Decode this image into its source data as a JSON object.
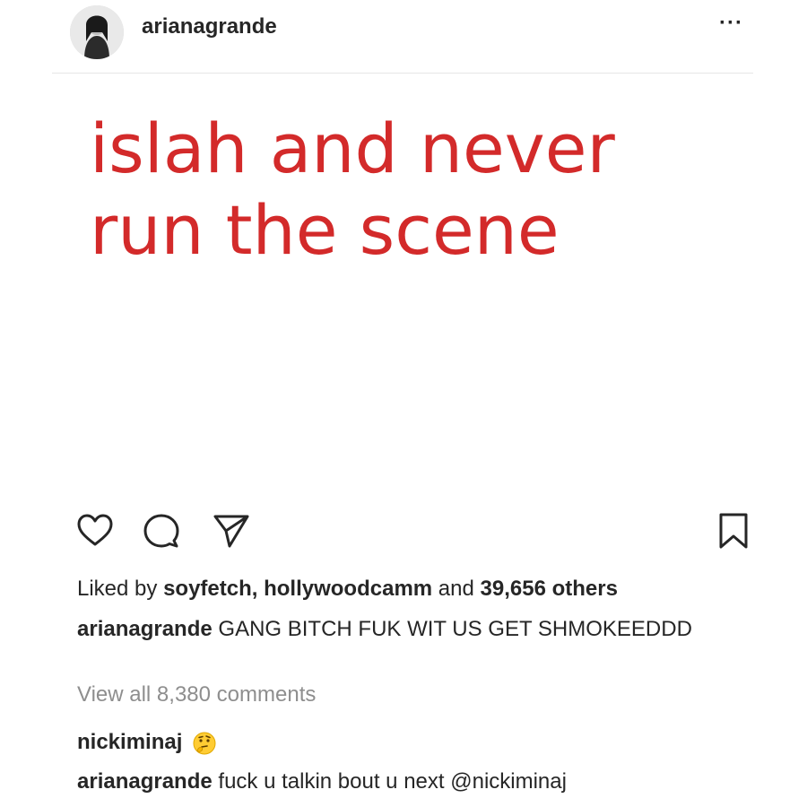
{
  "header": {
    "username": "arianagrande",
    "more_label": "···"
  },
  "post": {
    "image_text": {
      "line1": "islah and never",
      "line2": "run the scene"
    }
  },
  "actions": {
    "like_icon": "heart-icon",
    "comment_icon": "comment-bubble-icon",
    "share_icon": "send-icon",
    "save_icon": "bookmark-icon"
  },
  "likes": {
    "prefix": "Liked by",
    "users": "soyfetch, hollywoodcamm",
    "and": "and",
    "others": "39,656 others"
  },
  "caption": {
    "username": "arianagrande",
    "text": "GANG BITCH FUK WIT US GET SHMOKEEDDD"
  },
  "view_all_comments": "View all 8,380 comments",
  "comments": [
    {
      "username": "nickiminaj",
      "text": "",
      "emoji": "thinking-face-emoji"
    },
    {
      "username": "arianagrande",
      "text": "fuck u talkin bout u next @nickiminaj"
    }
  ],
  "colors": {
    "meme_text": "#d32a2a",
    "text": "#262626",
    "muted": "#8e8e8e"
  }
}
